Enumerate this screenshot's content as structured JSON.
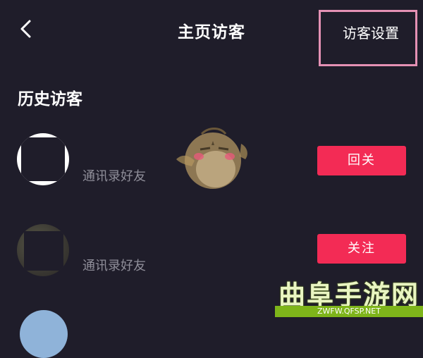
{
  "header": {
    "title": "主页访客",
    "settings_label": "访客设置"
  },
  "section": {
    "title": "历史访客"
  },
  "visitors": [
    {
      "relation": "通讯录好友",
      "action": "回关"
    },
    {
      "relation": "通讯录好友",
      "action": "关注"
    }
  ],
  "watermark": {
    "logo_text": "曲阜手游网",
    "url": "ZWFW.QFSP.NET"
  },
  "colors": {
    "background": "#1f1d2a",
    "action_button": "#f32b55",
    "highlight_box": "#e491b4",
    "watermark_green": "#7eb51a"
  },
  "icons": {
    "back": "chevron-left-icon"
  }
}
